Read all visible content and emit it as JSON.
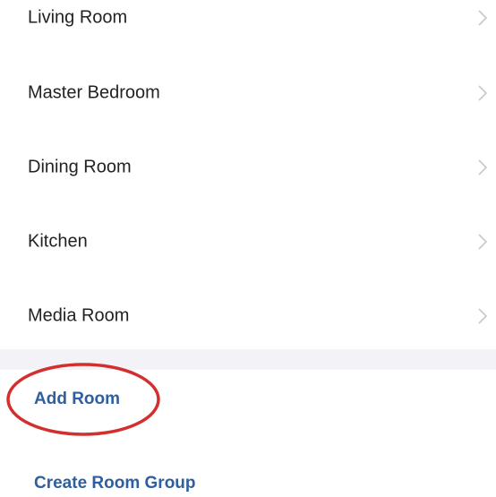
{
  "rooms": [
    {
      "label": "Living Room"
    },
    {
      "label": "Master Bedroom"
    },
    {
      "label": "Dining Room"
    },
    {
      "label": "Kitchen"
    },
    {
      "label": "Media Room"
    }
  ],
  "actions": {
    "add_room": "Add Room",
    "create_room_group": "Create Room Group"
  },
  "colors": {
    "action_text": "#2f5f9d",
    "divider_band": "#f2f2f7",
    "highlight_circle": "#d32f2f",
    "chevron": "#c7c7cc"
  },
  "icons": {
    "row_chevron": "chevron-right-icon"
  }
}
